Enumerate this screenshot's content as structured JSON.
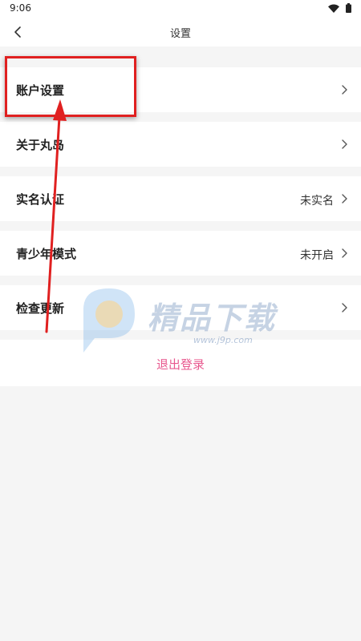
{
  "status_bar": {
    "time": "9:06",
    "icons": [
      "wifi-icon",
      "battery-icon"
    ]
  },
  "header": {
    "title": "设置",
    "back_icon": "chevron-left-icon"
  },
  "menu": {
    "items": [
      {
        "label": "账户设置",
        "value": ""
      },
      {
        "label": "关于丸岛",
        "value": ""
      },
      {
        "label": "实名认证",
        "value": "未实名"
      },
      {
        "label": "青少年模式",
        "value": "未开启"
      },
      {
        "label": "检查更新",
        "value": ""
      }
    ]
  },
  "logout": {
    "label": "退出登录"
  },
  "watermark": {
    "brand": "精品下载",
    "url": "www.j9p.com"
  },
  "colors": {
    "accent": "#e8588e",
    "annotation": "#e02020",
    "background": "#f5f5f5"
  }
}
